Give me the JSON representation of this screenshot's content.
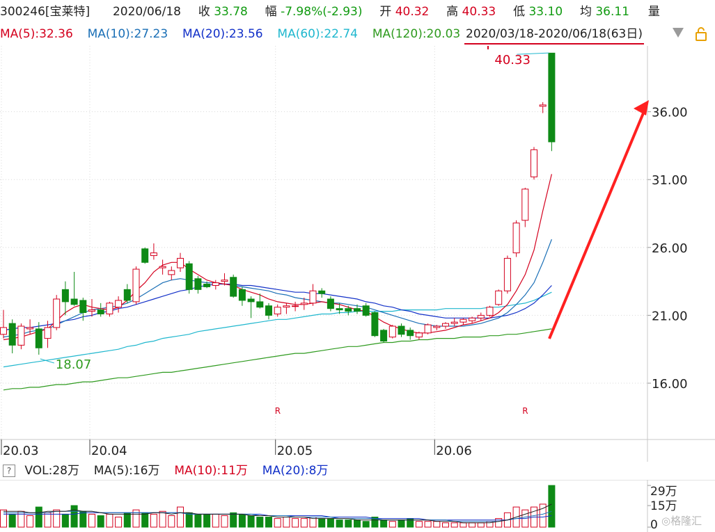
{
  "header": {
    "code": "300246[宝莱特]",
    "date": "2020/06/18",
    "close_label": "收",
    "close_value": "33.78",
    "change_label": "幅",
    "change_value": "-7.98%(-2.93)",
    "open_label": "开",
    "open_value": "40.32",
    "high_label": "高",
    "high_value": "40.33",
    "low_label": "低",
    "low_value": "33.10",
    "avg_label": "均",
    "avg_value": "36.11",
    "vol_label": "量"
  },
  "ma_bar": {
    "ma5": "MA(5):32.36",
    "ma10": "MA(10):27.23",
    "ma20": "MA(20):23.56",
    "ma60": "MA(60):22.74",
    "ma120": "MA(120):20.03",
    "range": "2020/03/18-2020/06/18(63日)"
  },
  "volume_bar": {
    "help": "?",
    "vol": "VOL:28万",
    "ma5": "MA(5):16万",
    "ma10": "MA(10):11万",
    "ma20": "MA(20):8万"
  },
  "colors": {
    "up": "#d4001e",
    "down": "#0e8a16",
    "ma5": "#d4001e",
    "ma10": "#1a6fb6",
    "ma20": "#1230c8",
    "ma60": "#1fb7ce",
    "ma120": "#2e9a1e",
    "arrow": "#ff2020"
  },
  "chart_data": {
    "type": "candlestick",
    "price_axis_labels": [
      "36.00",
      "31.00",
      "26.00",
      "21.00",
      "16.00"
    ],
    "price_axis_values": [
      36,
      31,
      26,
      21,
      16
    ],
    "ylim": [
      11.85,
      40.85
    ],
    "date_labels": [
      "20.03",
      "20.04",
      "20.05",
      "20.06"
    ],
    "date_label_index": [
      0,
      10,
      31,
      49
    ],
    "high_annotation": "40.33",
    "low_annotation": "18.07",
    "r_markers": [
      "R",
      "R"
    ],
    "r_marker_index": [
      31,
      59
    ],
    "candles": [
      {
        "o": 19.6,
        "h": 21.4,
        "l": 19.3,
        "c": 20.1
      },
      {
        "o": 20.4,
        "h": 20.7,
        "l": 18.2,
        "c": 18.8
      },
      {
        "o": 18.8,
        "h": 20.4,
        "l": 18.5,
        "c": 20.2
      },
      {
        "o": 20.0,
        "h": 20.7,
        "l": 19.6,
        "c": 20.1
      },
      {
        "o": 20.0,
        "h": 20.5,
        "l": 18.1,
        "c": 18.6
      },
      {
        "o": 19.3,
        "h": 20.6,
        "l": 18.6,
        "c": 20.1
      },
      {
        "o": 20.1,
        "h": 22.5,
        "l": 19.9,
        "c": 22.2
      },
      {
        "o": 22.9,
        "h": 23.5,
        "l": 21.0,
        "c": 22.0
      },
      {
        "o": 22.2,
        "h": 24.2,
        "l": 21.7,
        "c": 21.8
      },
      {
        "o": 22.1,
        "h": 22.3,
        "l": 20.6,
        "c": 21.2
      },
      {
        "o": 21.3,
        "h": 22.2,
        "l": 20.9,
        "c": 21.4
      },
      {
        "o": 21.4,
        "h": 21.9,
        "l": 20.9,
        "c": 21.1
      },
      {
        "o": 21.1,
        "h": 22.0,
        "l": 20.9,
        "c": 21.9
      },
      {
        "o": 21.6,
        "h": 22.4,
        "l": 21.2,
        "c": 22.1
      },
      {
        "o": 22.9,
        "h": 23.3,
        "l": 21.9,
        "c": 22.1
      },
      {
        "o": 22.0,
        "h": 24.6,
        "l": 21.8,
        "c": 24.4
      },
      {
        "o": 25.9,
        "h": 26.0,
        "l": 24.8,
        "c": 24.9
      },
      {
        "o": 25.4,
        "h": 26.3,
        "l": 25.1,
        "c": 25.6
      },
      {
        "o": 24.5,
        "h": 25.1,
        "l": 24.0,
        "c": 24.6
      },
      {
        "o": 24.0,
        "h": 24.6,
        "l": 23.6,
        "c": 24.3
      },
      {
        "o": 24.5,
        "h": 25.6,
        "l": 24.2,
        "c": 25.2
      },
      {
        "o": 24.8,
        "h": 25.0,
        "l": 22.6,
        "c": 22.9
      },
      {
        "o": 23.7,
        "h": 23.9,
        "l": 22.6,
        "c": 22.9
      },
      {
        "o": 23.3,
        "h": 23.5,
        "l": 23.0,
        "c": 23.1
      },
      {
        "o": 23.2,
        "h": 23.6,
        "l": 22.9,
        "c": 23.4
      },
      {
        "o": 23.5,
        "h": 24.1,
        "l": 23.2,
        "c": 23.6
      },
      {
        "o": 23.8,
        "h": 24.0,
        "l": 22.3,
        "c": 22.4
      },
      {
        "o": 22.9,
        "h": 23.1,
        "l": 21.7,
        "c": 22.1
      },
      {
        "o": 22.2,
        "h": 22.4,
        "l": 20.8,
        "c": 22.0
      },
      {
        "o": 22.0,
        "h": 22.6,
        "l": 21.5,
        "c": 21.6
      },
      {
        "o": 21.7,
        "h": 21.9,
        "l": 20.7,
        "c": 21.0
      },
      {
        "o": 21.1,
        "h": 21.8,
        "l": 20.9,
        "c": 21.6
      },
      {
        "o": 21.6,
        "h": 21.9,
        "l": 21.1,
        "c": 21.7
      },
      {
        "o": 21.7,
        "h": 22.0,
        "l": 21.3,
        "c": 21.7
      },
      {
        "o": 21.8,
        "h": 22.3,
        "l": 21.4,
        "c": 21.9
      },
      {
        "o": 21.9,
        "h": 23.3,
        "l": 21.7,
        "c": 22.8
      },
      {
        "o": 22.8,
        "h": 23.0,
        "l": 22.3,
        "c": 22.6
      },
      {
        "o": 22.2,
        "h": 22.4,
        "l": 21.3,
        "c": 21.5
      },
      {
        "o": 21.5,
        "h": 21.9,
        "l": 21.1,
        "c": 21.4
      },
      {
        "o": 21.5,
        "h": 21.7,
        "l": 21.0,
        "c": 21.3
      },
      {
        "o": 21.5,
        "h": 21.8,
        "l": 21.1,
        "c": 21.3
      },
      {
        "o": 21.7,
        "h": 21.9,
        "l": 20.9,
        "c": 21.0
      },
      {
        "o": 21.2,
        "h": 21.3,
        "l": 19.4,
        "c": 19.5
      },
      {
        "o": 19.9,
        "h": 20.0,
        "l": 19.0,
        "c": 19.1
      },
      {
        "o": 19.4,
        "h": 20.3,
        "l": 19.3,
        "c": 20.2
      },
      {
        "o": 20.2,
        "h": 20.4,
        "l": 19.4,
        "c": 19.6
      },
      {
        "o": 19.9,
        "h": 20.1,
        "l": 19.2,
        "c": 19.5
      },
      {
        "o": 19.4,
        "h": 19.8,
        "l": 19.2,
        "c": 19.7
      },
      {
        "o": 19.7,
        "h": 20.4,
        "l": 19.6,
        "c": 20.3
      },
      {
        "o": 20.1,
        "h": 20.3,
        "l": 19.9,
        "c": 20.2
      },
      {
        "o": 20.2,
        "h": 20.5,
        "l": 20.0,
        "c": 20.4
      },
      {
        "o": 20.4,
        "h": 20.8,
        "l": 20.2,
        "c": 20.5
      },
      {
        "o": 20.5,
        "h": 20.8,
        "l": 20.3,
        "c": 20.7
      },
      {
        "o": 20.6,
        "h": 20.9,
        "l": 20.4,
        "c": 20.8
      },
      {
        "o": 20.8,
        "h": 21.2,
        "l": 20.6,
        "c": 21.0
      },
      {
        "o": 21.0,
        "h": 21.7,
        "l": 20.9,
        "c": 21.6
      },
      {
        "o": 21.8,
        "h": 22.9,
        "l": 21.7,
        "c": 22.8
      },
      {
        "o": 22.8,
        "h": 25.4,
        "l": 22.6,
        "c": 25.2
      },
      {
        "o": 25.6,
        "h": 28.0,
        "l": 25.3,
        "c": 27.8
      },
      {
        "o": 28.0,
        "h": 30.4,
        "l": 27.5,
        "c": 30.3
      },
      {
        "o": 31.2,
        "h": 33.4,
        "l": 31.0,
        "c": 33.2
      },
      {
        "o": 36.4,
        "h": 36.7,
        "l": 35.9,
        "c": 36.5
      },
      {
        "o": 40.32,
        "h": 40.33,
        "l": 33.1,
        "c": 33.78
      }
    ],
    "ma5": [
      19.2,
      19.3,
      19.4,
      19.6,
      19.8,
      20.0,
      20.6,
      21.2,
      21.6,
      21.8,
      21.6,
      21.5,
      21.4,
      21.6,
      22.1,
      22.8,
      23.4,
      24.2,
      24.7,
      24.9,
      24.9,
      24.4,
      24.0,
      23.6,
      23.4,
      23.3,
      23.2,
      22.9,
      22.7,
      22.5,
      22.2,
      22.0,
      21.9,
      21.8,
      21.8,
      21.9,
      22.0,
      21.9,
      21.8,
      21.6,
      21.4,
      21.3,
      20.9,
      20.5,
      20.2,
      20.0,
      19.8,
      19.7,
      19.7,
      19.8,
      19.9,
      20.1,
      20.3,
      20.4,
      20.6,
      20.8,
      21.2,
      21.8,
      22.8,
      24.0,
      25.8,
      28.7,
      31.4
    ],
    "ma10": [
      19.4,
      19.5,
      19.6,
      19.8,
      19.9,
      20.0,
      20.3,
      20.6,
      20.9,
      21.2,
      21.4,
      21.5,
      21.6,
      21.7,
      21.9,
      22.2,
      22.6,
      23.0,
      23.4,
      23.6,
      23.7,
      23.6,
      23.5,
      23.4,
      23.4,
      23.3,
      23.2,
      23.1,
      23.0,
      22.9,
      22.8,
      22.6,
      22.5,
      22.3,
      22.2,
      22.1,
      22.0,
      21.9,
      21.9,
      21.8,
      21.7,
      21.6,
      21.4,
      21.2,
      21.0,
      20.8,
      20.6,
      20.4,
      20.3,
      20.2,
      20.2,
      20.2,
      20.2,
      20.3,
      20.4,
      20.6,
      20.8,
      21.2,
      21.8,
      22.5,
      23.4,
      24.9,
      26.6
    ],
    "ma20": [
      19.9,
      20.0,
      20.1,
      20.1,
      20.2,
      20.3,
      20.4,
      20.6,
      20.7,
      20.9,
      21.0,
      21.2,
      21.3,
      21.5,
      21.6,
      21.8,
      22.0,
      22.2,
      22.4,
      22.6,
      22.8,
      22.9,
      23.1,
      23.2,
      23.3,
      23.3,
      23.3,
      23.2,
      23.2,
      23.1,
      23.0,
      22.9,
      22.8,
      22.7,
      22.7,
      22.6,
      22.6,
      22.5,
      22.4,
      22.3,
      22.2,
      22.0,
      21.9,
      21.7,
      21.6,
      21.4,
      21.3,
      21.1,
      21.0,
      20.9,
      20.8,
      20.8,
      20.8,
      20.8,
      20.8,
      20.8,
      20.9,
      21.0,
      21.2,
      21.5,
      21.9,
      22.5,
      23.2
    ],
    "ma60": [
      17.2,
      17.3,
      17.4,
      17.5,
      17.6,
      17.7,
      17.8,
      17.9,
      18.0,
      18.1,
      18.2,
      18.3,
      18.4,
      18.5,
      18.7,
      18.8,
      19.0,
      19.1,
      19.3,
      19.4,
      19.5,
      19.6,
      19.8,
      19.9,
      20.0,
      20.1,
      20.2,
      20.3,
      20.4,
      20.5,
      20.6,
      20.7,
      20.7,
      20.8,
      20.9,
      21.0,
      21.1,
      21.1,
      21.2,
      21.2,
      21.3,
      21.3,
      21.3,
      21.3,
      21.3,
      21.4,
      21.4,
      21.4,
      21.4,
      21.4,
      21.5,
      21.5,
      21.5,
      21.5,
      21.5,
      21.6,
      21.6,
      21.7,
      21.8,
      21.9,
      22.1,
      22.4,
      22.7
    ],
    "ma120": [
      15.5,
      15.6,
      15.6,
      15.7,
      15.7,
      15.8,
      15.9,
      15.9,
      16.0,
      16.1,
      16.1,
      16.2,
      16.3,
      16.4,
      16.4,
      16.5,
      16.6,
      16.7,
      16.8,
      16.8,
      16.9,
      17.0,
      17.1,
      17.2,
      17.3,
      17.4,
      17.5,
      17.6,
      17.7,
      17.8,
      17.9,
      18.0,
      18.1,
      18.2,
      18.2,
      18.3,
      18.4,
      18.5,
      18.6,
      18.7,
      18.7,
      18.8,
      18.9,
      19.0,
      19.0,
      19.1,
      19.1,
      19.2,
      19.2,
      19.3,
      19.3,
      19.3,
      19.4,
      19.4,
      19.4,
      19.5,
      19.5,
      19.6,
      19.6,
      19.7,
      19.8,
      19.9,
      20.0
    ],
    "volume": {
      "axis_labels": [
        "29万",
        "15万",
        "0"
      ],
      "axis_values": [
        29,
        15,
        0
      ],
      "max": 30,
      "bars": [
        12,
        9,
        11,
        8,
        14,
        10,
        12,
        9,
        15,
        11,
        9,
        8,
        9,
        7,
        10,
        12,
        10,
        9,
        11,
        8,
        14,
        10,
        9,
        9,
        9,
        8,
        10,
        9,
        8,
        7,
        7,
        6,
        7,
        6,
        6,
        7,
        6,
        6,
        5,
        5,
        5,
        4,
        7,
        5,
        4,
        5,
        6,
        4,
        4,
        4,
        3,
        3,
        3,
        3,
        3,
        4,
        6,
        10,
        14,
        12,
        14,
        16,
        29
      ],
      "ma5": [
        11,
        11,
        11,
        10,
        10,
        11,
        11,
        11,
        12,
        11,
        11,
        10,
        9,
        9,
        9,
        9,
        9,
        10,
        10,
        9,
        10,
        10,
        9,
        9,
        9,
        9,
        9,
        9,
        8,
        8,
        8,
        7,
        7,
        7,
        7,
        6,
        6,
        6,
        6,
        6,
        5,
        5,
        5,
        5,
        5,
        5,
        5,
        5,
        5,
        4,
        4,
        4,
        3,
        3,
        3,
        3,
        4,
        5,
        7,
        9,
        11,
        13,
        16
      ],
      "ma10": [
        10,
        10,
        10,
        10,
        10,
        10,
        11,
        11,
        11,
        11,
        11,
        10,
        10,
        10,
        10,
        10,
        10,
        10,
        10,
        10,
        10,
        9,
        9,
        9,
        9,
        9,
        9,
        9,
        9,
        8,
        8,
        8,
        8,
        7,
        7,
        7,
        7,
        7,
        6,
        6,
        6,
        6,
        6,
        5,
        5,
        5,
        5,
        5,
        5,
        5,
        5,
        4,
        4,
        4,
        4,
        4,
        4,
        5,
        6,
        7,
        8,
        9,
        11
      ],
      "ma20": [
        9,
        9,
        9,
        9,
        9,
        9,
        9,
        9,
        9,
        10,
        10,
        10,
        10,
        10,
        10,
        10,
        10,
        10,
        10,
        10,
        10,
        9,
        9,
        9,
        9,
        9,
        9,
        9,
        9,
        9,
        8,
        8,
        8,
        8,
        8,
        8,
        8,
        7,
        7,
        7,
        7,
        7,
        6,
        6,
        6,
        6,
        6,
        6,
        5,
        5,
        5,
        5,
        5,
        5,
        5,
        5,
        5,
        5,
        6,
        6,
        7,
        7,
        8
      ]
    }
  }
}
